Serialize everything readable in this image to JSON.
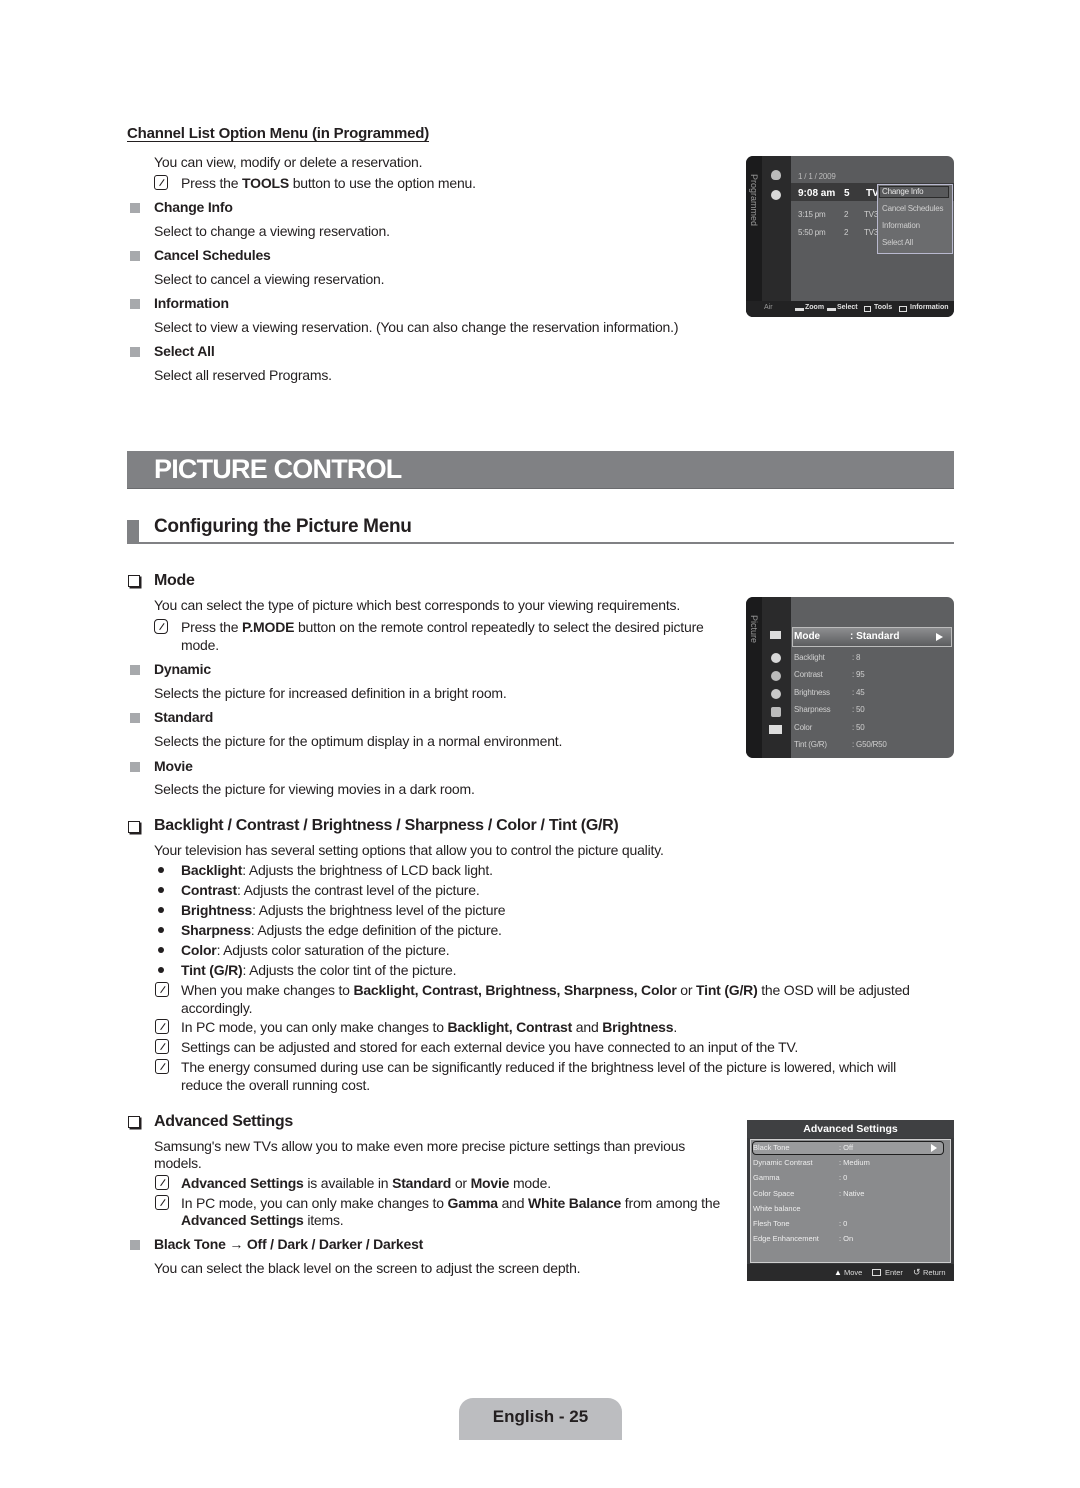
{
  "channel_list": {
    "heading": "Channel List Option Menu (in Programmed)",
    "intro": "You can view, modify or delete a reservation.",
    "note": {
      "pre": "Press the ",
      "bold": "TOOLS",
      "post": " button to use the option menu."
    },
    "items": [
      {
        "title": "Change Info",
        "desc": "Select to change a viewing reservation."
      },
      {
        "title": "Cancel Schedules",
        "desc": "Select to cancel a viewing reservation."
      },
      {
        "title": "Information",
        "desc": "Select to view a viewing reservation. (You can also change the reservation information.)"
      },
      {
        "title": "Select All",
        "desc": "Select all reserved Programs."
      }
    ]
  },
  "osd_programmed": {
    "side_label": "Programmed",
    "date": "1 / 1 / 2009",
    "current": {
      "time": "9:08 am",
      "ch": "5",
      "name": "TV"
    },
    "rows": [
      {
        "time": "3:15 pm",
        "ch": "2",
        "name": "TV3"
      },
      {
        "time": "5:50 pm",
        "ch": "2",
        "name": "TV3"
      }
    ],
    "popup": [
      "Change Info",
      "Cancel Schedules",
      "Information",
      "Select All"
    ],
    "footer": {
      "source": "Air",
      "zoom": "Zoom",
      "select": "Select",
      "tools": "Tools",
      "info": "Information"
    }
  },
  "banner": {
    "title": "PICTURE CONTROL"
  },
  "section": {
    "title": "Configuring the Picture Menu"
  },
  "mode": {
    "heading": "Mode",
    "intro": "You can select the type of picture which best corresponds to your viewing requirements.",
    "note": {
      "pre": "Press the ",
      "bold": "P.MODE",
      "post": " button on the remote control repeatedly to select the desired picture",
      "line2": "mode."
    },
    "items": [
      {
        "title": "Dynamic",
        "desc": "Selects the picture for increased definition in a bright room."
      },
      {
        "title": "Standard",
        "desc": "Selects the picture for the optimum display in a normal environment."
      },
      {
        "title": "Movie",
        "desc": "Selects the picture for viewing movies in a dark room."
      }
    ]
  },
  "osd_picture": {
    "side_label": "Picture",
    "selected": {
      "label": "Mode",
      "value": ": Standard"
    },
    "rows": [
      {
        "label": "Backlight",
        "value": ": 8"
      },
      {
        "label": "Contrast",
        "value": ": 95"
      },
      {
        "label": "Brightness",
        "value": ": 45"
      },
      {
        "label": "Sharpness",
        "value": ": 50"
      },
      {
        "label": "Color",
        "value": ": 50"
      },
      {
        "label": "Tint (G/R)",
        "value": ": G50/R50"
      }
    ]
  },
  "settings": {
    "heading": "Backlight / Contrast / Brightness / Sharpness / Color / Tint (G/R)",
    "intro": "Your television has several setting options that allow you to control the picture quality.",
    "bullets": [
      {
        "term": "Backlight",
        "text": ": Adjusts the brightness of LCD back light."
      },
      {
        "term": "Contrast",
        "text": ": Adjusts the contrast level of the picture."
      },
      {
        "term": "Brightness",
        "text": ": Adjusts the brightness level of the picture"
      },
      {
        "term": "Sharpness",
        "text": ": Adjusts the edge definition of the picture."
      },
      {
        "term": "Color",
        "text": ": Adjusts color saturation of the picture."
      },
      {
        "term": "Tint (G/R)",
        "text": ": Adjusts the color tint of the picture."
      }
    ],
    "notes": {
      "n1_pre": "When you make changes to ",
      "n1_bold": "Backlight, Contrast, Brightness, Sharpness, Color",
      "n1_mid": " or ",
      "n1_bold2": "Tint (G/R)",
      "n1_post": " the OSD will be adjusted",
      "n1_line2": "accordingly.",
      "n2_pre": "In PC mode, you can only make changes to ",
      "n2_bold": "Backlight, Contrast",
      "n2_mid": " and ",
      "n2_bold2": "Brightness",
      "n2_post": ".",
      "n3": "Settings can be adjusted and stored for each external device you have connected to an input of the TV.",
      "n4": "The energy consumed during use can be significantly reduced if the brightness level of the picture is lowered, which will",
      "n4_line2": "reduce the overall running cost."
    }
  },
  "advanced": {
    "heading": "Advanced Settings",
    "intro": "Samsung's new TVs allow you to make even more precise picture settings than previous",
    "intro_line2": "models.",
    "note1": {
      "bold": "Advanced Settings",
      "mid": " is available in ",
      "bold2": "Standard",
      "mid2": " or ",
      "bold3": "Movie",
      "post": " mode."
    },
    "note2": {
      "pre": "In PC mode, you can only make changes to ",
      "bold": "Gamma",
      "mid": " and ",
      "bold2": "White Balance",
      "post": " from among the",
      "line2_bold": "Advanced Settings",
      "line2_post": " items."
    },
    "item": {
      "title": "Black Tone → Off / Dark / Darker / Darkest",
      "desc": "You can select the black level on the screen to adjust the screen depth."
    }
  },
  "osd_advanced": {
    "title": "Advanced Settings",
    "rows": [
      {
        "label": "Black Tone",
        "value": ": Off"
      },
      {
        "label": "Dynamic Contrast",
        "value": ": Medium"
      },
      {
        "label": "Gamma",
        "value": ": 0"
      },
      {
        "label": "Color Space",
        "value": ": Native"
      },
      {
        "label": "White balance",
        "value": ""
      },
      {
        "label": "Flesh Tone",
        "value": ": 0"
      },
      {
        "label": "Edge Enhancement",
        "value": ": On"
      }
    ],
    "footer": {
      "move": "Move",
      "enter": "Enter",
      "return": "Return"
    }
  },
  "footer": {
    "page": "English - 25"
  }
}
